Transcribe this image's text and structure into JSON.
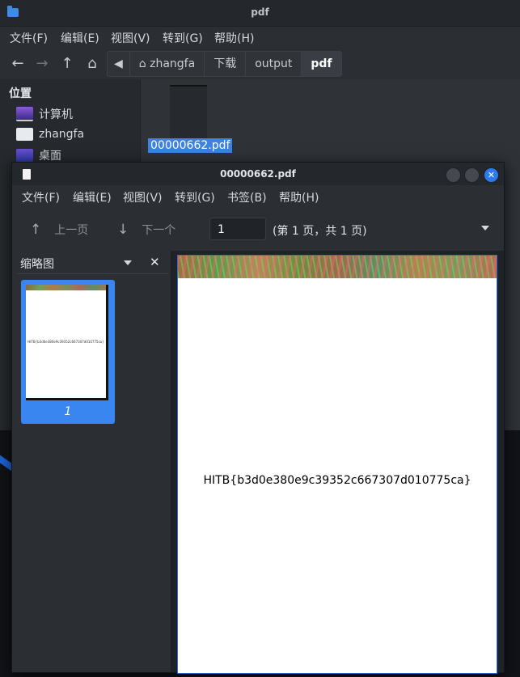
{
  "file_manager": {
    "title": "pdf",
    "menu": [
      "文件(F)",
      "编辑(E)",
      "视图(V)",
      "转到(G)",
      "帮助(H)"
    ],
    "breadcrumb": [
      "zhangfa",
      "下载",
      "output",
      "pdf"
    ],
    "sidebar": {
      "heading": "位置",
      "items": [
        {
          "label": "计算机",
          "icon": "computer-icon"
        },
        {
          "label": "zhangfa",
          "icon": "home-folder-icon"
        },
        {
          "label": "桌面",
          "icon": "desktop-icon"
        }
      ]
    },
    "selected_file": "00000662.pdf"
  },
  "viewer": {
    "title": "00000662.pdf",
    "menu": [
      "文件(F)",
      "编辑(E)",
      "视图(V)",
      "转到(G)",
      "书签(B)",
      "帮助(H)"
    ],
    "toolbar": {
      "prev_label": "上一页",
      "next_label": "下一个",
      "page_input": "1",
      "page_status": "(第 1 页，共 1 页)"
    },
    "sidebar": {
      "title": "缩略图",
      "thumb_label": "1"
    },
    "document": {
      "text": "HITB{b3d0e380e9c39352c667307d010775ca}"
    }
  }
}
